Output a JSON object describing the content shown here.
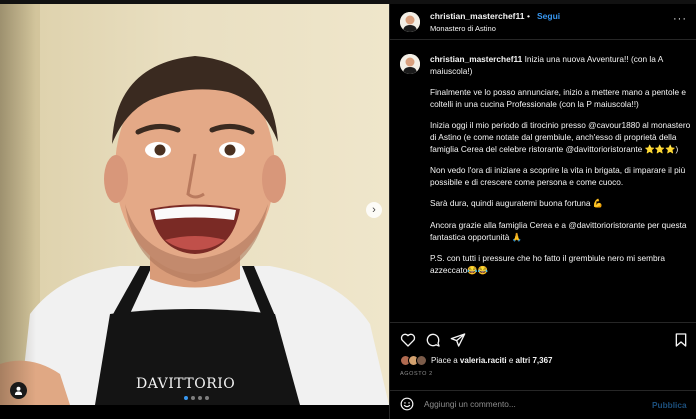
{
  "post": {
    "username": "christian_masterchef11",
    "follow_label": "Segui",
    "header_separator": "•",
    "location": "Monastero di Astino",
    "more_label": "···"
  },
  "media": {
    "apron_text": "DAVITTORIO",
    "carousel_next": "›",
    "carousel_count": 4,
    "carousel_index": 0
  },
  "caption": {
    "username": "christian_masterchef11",
    "paragraphs": [
      "Inizia una nuova Avventura!! (con la A maiuscola!)",
      "Finalmente ve lo posso annunciare, inizio a mettere mano a pentole e coltelli in una cucina Professionale (con la P maiuscola!!)",
      "Inizia oggi il mio periodo di tirocinio presso @cavour1880 al monastero di Astino (e come notate dal grembiule, anch'esso di proprietà della famiglia Cerea del celebre ristorante @davittorioristorante ⭐⭐⭐)",
      "Non vedo l'ora di iniziare a scoprire la vita in brigata, di imparare il più possibile e di crescere come persona e come cuoco.",
      "Sarà dura, quindi auguratemi buona fortuna 💪",
      "Ancora grazie alla famiglia Cerea e a @davittorioristorante per questa fantastica opportunità 🙏",
      "P.S. con tutti i pressure che ho fatto il grembiule nero mi sembra azzeccato😂😂"
    ]
  },
  "likes": {
    "prefix": "Piace a",
    "user": "valeria.raciti",
    "middle": "e",
    "others": "altri 7,367"
  },
  "date": "AGOSTO 2",
  "comment": {
    "placeholder": "Aggiungi un commento...",
    "publish_label": "Pubblica"
  },
  "colors": {
    "accent": "#3897f0",
    "publish_disabled": "#1c4f7c",
    "background": "#000000",
    "divider": "#262626"
  },
  "icons": {
    "actions": [
      "heart-icon",
      "comment-icon",
      "share-icon",
      "bookmark-icon"
    ],
    "photo": [
      "chevron-right-icon",
      "user-tag-icon"
    ],
    "comment": "emoji-icon"
  }
}
